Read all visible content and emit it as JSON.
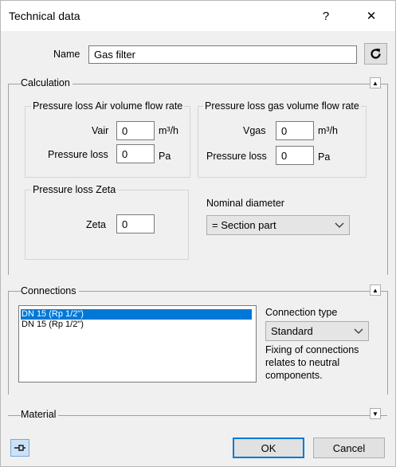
{
  "window": {
    "title": "Technical data",
    "help_label": "?",
    "close_label": "✕"
  },
  "name_field": {
    "label": "Name",
    "value": "Gas filter"
  },
  "calculation": {
    "label": "Calculation",
    "air_group": {
      "label": "Pressure loss Air volume flow rate",
      "vair_label": "Vair",
      "vair_value": "0",
      "vair_unit": "m³/h",
      "pressure_label": "Pressure loss",
      "pressure_value": "0",
      "pressure_unit": "Pa"
    },
    "gas_group": {
      "label": "Pressure loss gas volume flow rate",
      "vgas_label": "Vgas",
      "vgas_value": "0",
      "vgas_unit": "m³/h",
      "pressure_label": "Pressure loss",
      "pressure_value": "0",
      "pressure_unit": "Pa"
    },
    "zeta_group": {
      "label": "Pressure loss Zeta",
      "zeta_label": "Zeta",
      "zeta_value": "0"
    },
    "nominal_diameter": {
      "label": "Nominal diameter",
      "selected": "= Section part"
    }
  },
  "connections": {
    "label": "Connections",
    "items": [
      "DN 15 (Rp 1/2\")",
      "DN 15 (Rp 1/2\")"
    ],
    "connection_type_label": "Connection type",
    "connection_type_selected": "Standard",
    "note": "Fixing of connections relates to neutral components."
  },
  "material": {
    "label": "Material"
  },
  "footer": {
    "ok_label": "OK",
    "cancel_label": "Cancel"
  },
  "colors": {
    "accent": "#0078d7",
    "background": "#f0f0f0"
  }
}
